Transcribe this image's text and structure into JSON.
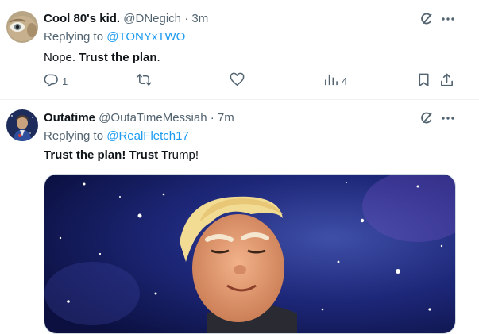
{
  "tweets": [
    {
      "display_name": "Cool 80's kid.",
      "handle": "@DNegich",
      "separator": "·",
      "time": "3m",
      "replying_prefix": "Replying to",
      "replying_to": "@TONYxTWO",
      "text_plain_1": "Nope. ",
      "text_bold_1": "Trust the plan",
      "text_plain_2": ".",
      "stats": {
        "replies": "1",
        "views": "4"
      }
    },
    {
      "display_name": "Outatime",
      "handle": "@OutaTimeMessiah",
      "separator": "·",
      "time": "7m",
      "replying_prefix": "Replying to",
      "replying_to": "@RealFletch17",
      "text_bold_1": "Trust the plan! Trust",
      "text_plain_1": " Trump!"
    }
  ],
  "icons": [
    "grok-icon",
    "more-icon",
    "reply-icon",
    "retweet-icon",
    "like-icon",
    "views-icon",
    "bookmark-icon",
    "share-icon"
  ],
  "colors": {
    "link": "#1d9bf0",
    "muted": "#536471",
    "text": "#0f1419",
    "divider": "#eff3f4"
  }
}
